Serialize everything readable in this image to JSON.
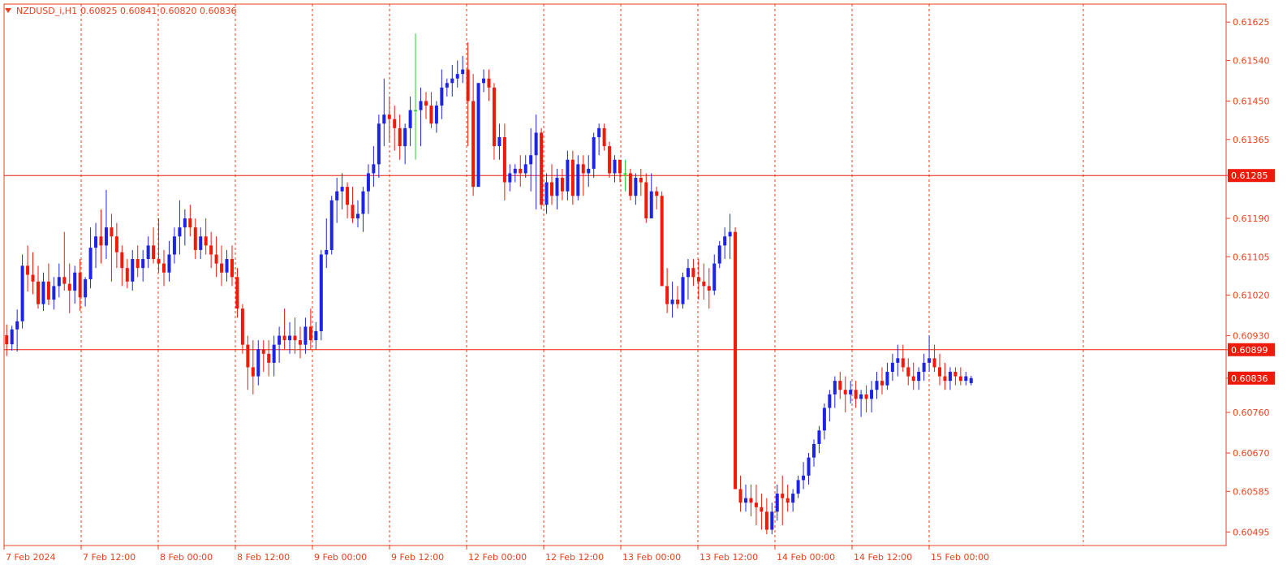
{
  "header": {
    "symbol_timeframe": "NZDUSD_i,H1",
    "ohlc": "0.60825 0.60841 0.60820 0.60836",
    "collapse_icon": "triangle-down-icon"
  },
  "colors": {
    "background": "#ffffff",
    "frame": "#e8421c",
    "grid": "#e8421c",
    "bull": "#1d24e6",
    "bear": "#f01a0a",
    "doji": "#2ecb2e",
    "axis_text": "#e8421c",
    "hline": "#f01a0a"
  },
  "chart_data": {
    "type": "candlestick",
    "instrument": "NZDUSD_i",
    "timeframe": "H1",
    "ylim": [
      0.60465,
      0.61665
    ],
    "y_ticks": [
      "0.61625",
      "0.61540",
      "0.61450",
      "0.61365",
      "0.61285",
      "0.61190",
      "0.61105",
      "0.61020",
      "0.60930",
      "0.60899",
      "0.60836",
      "0.60760",
      "0.60670",
      "0.60585",
      "0.60495"
    ],
    "highlight_levels": [
      "0.61285",
      "0.60899",
      "0.60836"
    ],
    "x_ticks": [
      "7 Feb 2024",
      "7 Feb 12:00",
      "8 Feb 00:00",
      "8 Feb 12:00",
      "9 Feb 00:00",
      "9 Feb 12:00",
      "12 Feb 00:00",
      "12 Feb 12:00",
      "13 Feb 00:00",
      "13 Feb 12:00",
      "14 Feb 00:00",
      "14 Feb 12:00",
      "15 Feb 00:00"
    ],
    "horizontal_lines": [
      0.61285,
      0.60899
    ],
    "current_price": 0.60836,
    "bar_count": 190,
    "candles": [
      [
        0.60931,
        0.60955,
        0.60885,
        0.60911
      ],
      [
        0.60911,
        0.60952,
        0.60897,
        0.60944
      ],
      [
        0.60944,
        0.60988,
        0.60895,
        0.60962
      ],
      [
        0.60962,
        0.6111,
        0.60946,
        0.61085
      ],
      [
        0.61085,
        0.6113,
        0.61028,
        0.61065
      ],
      [
        0.61065,
        0.61115,
        0.61022,
        0.6105
      ],
      [
        0.6105,
        0.61085,
        0.6099,
        0.61
      ],
      [
        0.61,
        0.6107,
        0.60985,
        0.6105
      ],
      [
        0.6105,
        0.6109,
        0.60998,
        0.6101
      ],
      [
        0.6101,
        0.6106,
        0.60988,
        0.6104
      ],
      [
        0.6104,
        0.6109,
        0.61015,
        0.6106
      ],
      [
        0.6106,
        0.6116,
        0.6103,
        0.61045
      ],
      [
        0.61045,
        0.6109,
        0.6098,
        0.6103
      ],
      [
        0.6103,
        0.61085,
        0.61001,
        0.6107
      ],
      [
        0.6107,
        0.611,
        0.60985,
        0.61015
      ],
      [
        0.61015,
        0.6106,
        0.60995,
        0.61055
      ],
      [
        0.61055,
        0.6117,
        0.61035,
        0.61125
      ],
      [
        0.61125,
        0.6118,
        0.6108,
        0.6115
      ],
      [
        0.6115,
        0.6121,
        0.6109,
        0.6113
      ],
      [
        0.6113,
        0.61253,
        0.611,
        0.6117
      ],
      [
        0.6117,
        0.612,
        0.6105,
        0.6115
      ],
      [
        0.6115,
        0.6118,
        0.6108,
        0.61115
      ],
      [
        0.61115,
        0.6113,
        0.6104,
        0.6108
      ],
      [
        0.6108,
        0.611,
        0.61035,
        0.6105
      ],
      [
        0.6105,
        0.6112,
        0.6103,
        0.611
      ],
      [
        0.611,
        0.6113,
        0.6106,
        0.6108
      ],
      [
        0.6108,
        0.6112,
        0.6105,
        0.611
      ],
      [
        0.611,
        0.6115,
        0.6108,
        0.6113
      ],
      [
        0.6113,
        0.6117,
        0.6109,
        0.611
      ],
      [
        0.611,
        0.6119,
        0.6107,
        0.6109
      ],
      [
        0.6109,
        0.6112,
        0.6104,
        0.6107
      ],
      [
        0.6107,
        0.6114,
        0.6105,
        0.6111
      ],
      [
        0.6111,
        0.6117,
        0.6109,
        0.6115
      ],
      [
        0.6115,
        0.6123,
        0.6111,
        0.6117
      ],
      [
        0.6117,
        0.6121,
        0.6113,
        0.6119
      ],
      [
        0.6119,
        0.6122,
        0.6115,
        0.6117
      ],
      [
        0.6117,
        0.6119,
        0.611,
        0.6112
      ],
      [
        0.6112,
        0.6117,
        0.611,
        0.6115
      ],
      [
        0.6115,
        0.6119,
        0.6111,
        0.6113
      ],
      [
        0.6113,
        0.6116,
        0.6108,
        0.6111
      ],
      [
        0.6111,
        0.6115,
        0.6106,
        0.6109
      ],
      [
        0.6109,
        0.6113,
        0.6104,
        0.6107
      ],
      [
        0.6107,
        0.6112,
        0.6105,
        0.611
      ],
      [
        0.611,
        0.6113,
        0.6104,
        0.6106
      ],
      [
        0.6106,
        0.6108,
        0.6097,
        0.6099
      ],
      [
        0.6099,
        0.61,
        0.6089,
        0.6091
      ],
      [
        0.6091,
        0.6093,
        0.6081,
        0.6086
      ],
      [
        0.6086,
        0.6092,
        0.608,
        0.6084
      ],
      [
        0.6084,
        0.6092,
        0.6082,
        0.609
      ],
      [
        0.609,
        0.6092,
        0.6085,
        0.6089
      ],
      [
        0.6089,
        0.6092,
        0.6084,
        0.6087
      ],
      [
        0.6087,
        0.6093,
        0.6084,
        0.6091
      ],
      [
        0.6091,
        0.6095,
        0.6087,
        0.6093
      ],
      [
        0.6093,
        0.6099,
        0.609,
        0.6092
      ],
      [
        0.6092,
        0.6096,
        0.6089,
        0.6093
      ],
      [
        0.6093,
        0.6097,
        0.6089,
        0.6092
      ],
      [
        0.6092,
        0.6095,
        0.6088,
        0.6091
      ],
      [
        0.6091,
        0.6097,
        0.6089,
        0.6095
      ],
      [
        0.6095,
        0.6099,
        0.609,
        0.6092
      ],
      [
        0.6092,
        0.6096,
        0.609,
        0.6094
      ],
      [
        0.6094,
        0.6112,
        0.6092,
        0.6111
      ],
      [
        0.6111,
        0.6119,
        0.6108,
        0.6112
      ],
      [
        0.6112,
        0.6124,
        0.6111,
        0.6123
      ],
      [
        0.6123,
        0.6128,
        0.6118,
        0.6125
      ],
      [
        0.6125,
        0.6129,
        0.6121,
        0.6126
      ],
      [
        0.6126,
        0.6127,
        0.6119,
        0.6122
      ],
      [
        0.6122,
        0.6126,
        0.6118,
        0.6119
      ],
      [
        0.6119,
        0.6123,
        0.6117,
        0.612
      ],
      [
        0.612,
        0.6126,
        0.6116,
        0.6125
      ],
      [
        0.6125,
        0.6131,
        0.612,
        0.6129
      ],
      [
        0.6129,
        0.6135,
        0.6126,
        0.6131
      ],
      [
        0.6131,
        0.6142,
        0.6128,
        0.614
      ],
      [
        0.614,
        0.615,
        0.6135,
        0.6142
      ],
      [
        0.6142,
        0.6146,
        0.6136,
        0.6141
      ],
      [
        0.6141,
        0.6144,
        0.6134,
        0.6139
      ],
      [
        0.6139,
        0.6142,
        0.6132,
        0.6135
      ],
      [
        0.6135,
        0.614,
        0.6131,
        0.6139
      ],
      [
        0.6139,
        0.6146,
        0.6135,
        0.6143
      ],
      [
        0.6143,
        0.616,
        0.6132,
        0.6143
      ],
      [
        0.6143,
        0.6148,
        0.6135,
        0.6145
      ],
      [
        0.6145,
        0.6147,
        0.6141,
        0.6144
      ],
      [
        0.6144,
        0.6147,
        0.6139,
        0.614
      ],
      [
        0.614,
        0.6145,
        0.6138,
        0.6144
      ],
      [
        0.6144,
        0.6152,
        0.6141,
        0.6148
      ],
      [
        0.6148,
        0.615,
        0.6146,
        0.6149
      ],
      [
        0.6149,
        0.6153,
        0.6146,
        0.615
      ],
      [
        0.615,
        0.6154,
        0.6148,
        0.6151
      ],
      [
        0.6151,
        0.6155,
        0.6149,
        0.6152
      ],
      [
        0.6152,
        0.6158,
        0.6135,
        0.6145
      ],
      [
        0.6145,
        0.6151,
        0.6124,
        0.6126
      ],
      [
        0.6126,
        0.6149,
        0.6126,
        0.6149
      ],
      [
        0.6149,
        0.6152,
        0.6147,
        0.615
      ],
      [
        0.615,
        0.6152,
        0.6145,
        0.6148
      ],
      [
        0.6148,
        0.6149,
        0.6132,
        0.6135
      ],
      [
        0.6135,
        0.614,
        0.6132,
        0.6137
      ],
      [
        0.6137,
        0.614,
        0.6123,
        0.6127
      ],
      [
        0.6127,
        0.6131,
        0.6125,
        0.6129
      ],
      [
        0.6129,
        0.6131,
        0.6127,
        0.613
      ],
      [
        0.613,
        0.6133,
        0.6126,
        0.6129
      ],
      [
        0.6129,
        0.6133,
        0.6128,
        0.6131
      ],
      [
        0.6131,
        0.6139,
        0.6125,
        0.6133
      ],
      [
        0.6133,
        0.6142,
        0.6121,
        0.6138
      ],
      [
        0.6138,
        0.6139,
        0.6121,
        0.6122
      ],
      [
        0.6122,
        0.6129,
        0.612,
        0.6127
      ],
      [
        0.6127,
        0.6131,
        0.6122,
        0.6124
      ],
      [
        0.6124,
        0.613,
        0.6121,
        0.6128
      ],
      [
        0.6128,
        0.613,
        0.6123,
        0.6125
      ],
      [
        0.6125,
        0.6134,
        0.6123,
        0.6132
      ],
      [
        0.6132,
        0.6134,
        0.6122,
        0.6124
      ],
      [
        0.6124,
        0.6133,
        0.6123,
        0.6131
      ],
      [
        0.6131,
        0.6133,
        0.6124,
        0.6129
      ],
      [
        0.6129,
        0.6133,
        0.6126,
        0.613
      ],
      [
        0.613,
        0.6138,
        0.6128,
        0.6137
      ],
      [
        0.6137,
        0.614,
        0.6133,
        0.6139
      ],
      [
        0.6139,
        0.614,
        0.6134,
        0.6135
      ],
      [
        0.6135,
        0.6136,
        0.6128,
        0.6129
      ],
      [
        0.6129,
        0.6133,
        0.6127,
        0.6132
      ],
      [
        0.6132,
        0.6132,
        0.6127,
        0.6129
      ],
      [
        0.6129,
        0.6132,
        0.6125,
        0.6129
      ],
      [
        0.6129,
        0.613,
        0.6123,
        0.6124
      ],
      [
        0.6124,
        0.6129,
        0.6122,
        0.6128
      ],
      [
        0.6128,
        0.613,
        0.6124,
        0.6127
      ],
      [
        0.6127,
        0.6129,
        0.6118,
        0.6119
      ],
      [
        0.6119,
        0.6129,
        0.612,
        0.6125
      ],
      [
        0.6125,
        0.6126,
        0.6121,
        0.6124
      ],
      [
        0.6124,
        0.6125,
        0.6105,
        0.6104
      ],
      [
        0.6104,
        0.6108,
        0.6098,
        0.61
      ],
      [
        0.61,
        0.6105,
        0.6097,
        0.6101
      ],
      [
        0.6101,
        0.6104,
        0.6099,
        0.61
      ],
      [
        0.61,
        0.6107,
        0.6099,
        0.6106
      ],
      [
        0.6106,
        0.611,
        0.6101,
        0.6108
      ],
      [
        0.6108,
        0.611,
        0.6104,
        0.6106
      ],
      [
        0.6106,
        0.611,
        0.6101,
        0.6105
      ],
      [
        0.6105,
        0.6109,
        0.6101,
        0.6104
      ],
      [
        0.6104,
        0.6108,
        0.6099,
        0.6103
      ],
      [
        0.6103,
        0.6111,
        0.6102,
        0.6109
      ],
      [
        0.6109,
        0.6114,
        0.6108,
        0.6113
      ],
      [
        0.6113,
        0.6117,
        0.611,
        0.6115
      ],
      [
        0.6115,
        0.612,
        0.611,
        0.6116
      ],
      [
        0.6116,
        0.6117,
        0.6063,
        0.6059
      ],
      [
        0.6059,
        0.6062,
        0.6054,
        0.6056
      ],
      [
        0.6056,
        0.606,
        0.6054,
        0.6057
      ],
      [
        0.6057,
        0.606,
        0.6053,
        0.6056
      ],
      [
        0.6056,
        0.606,
        0.6051,
        0.6055
      ],
      [
        0.6055,
        0.6058,
        0.605,
        0.6054
      ],
      [
        0.6054,
        0.6057,
        0.6049,
        0.605
      ],
      [
        0.605,
        0.6056,
        0.6049,
        0.6054
      ],
      [
        0.6054,
        0.606,
        0.6052,
        0.6058
      ],
      [
        0.6058,
        0.6062,
        0.6051,
        0.6057
      ],
      [
        0.6057,
        0.606,
        0.6054,
        0.6056
      ],
      [
        0.6056,
        0.6059,
        0.6054,
        0.6058
      ],
      [
        0.6058,
        0.6062,
        0.6057,
        0.6061
      ],
      [
        0.6061,
        0.6065,
        0.6059,
        0.6062
      ],
      [
        0.6062,
        0.6067,
        0.606,
        0.6066
      ],
      [
        0.6066,
        0.607,
        0.6064,
        0.6069
      ],
      [
        0.6069,
        0.6073,
        0.6067,
        0.6072
      ],
      [
        0.6072,
        0.6078,
        0.607,
        0.6077
      ],
      [
        0.6077,
        0.6081,
        0.6074,
        0.608
      ],
      [
        0.608,
        0.6084,
        0.6077,
        0.6083
      ],
      [
        0.6083,
        0.6085,
        0.6079,
        0.6081
      ],
      [
        0.6081,
        0.6084,
        0.6076,
        0.608
      ],
      [
        0.608,
        0.6083,
        0.6078,
        0.6081
      ],
      [
        0.6081,
        0.6083,
        0.6077,
        0.6079
      ],
      [
        0.6079,
        0.6081,
        0.6075,
        0.608
      ],
      [
        0.608,
        0.6082,
        0.6076,
        0.6079
      ],
      [
        0.6079,
        0.6083,
        0.6076,
        0.6081
      ],
      [
        0.6081,
        0.6085,
        0.6079,
        0.6083
      ],
      [
        0.6083,
        0.6086,
        0.608,
        0.6082
      ],
      [
        0.6082,
        0.6087,
        0.6081,
        0.6085
      ],
      [
        0.6085,
        0.6089,
        0.6083,
        0.6087
      ],
      [
        0.6087,
        0.6091,
        0.6084,
        0.6088
      ],
      [
        0.6088,
        0.6091,
        0.6085,
        0.6086
      ],
      [
        0.6086,
        0.6088,
        0.6082,
        0.6084
      ],
      [
        0.6084,
        0.6087,
        0.6081,
        0.6083
      ],
      [
        0.6083,
        0.6086,
        0.6081,
        0.6085
      ],
      [
        0.6085,
        0.6089,
        0.6083,
        0.6087
      ],
      [
        0.6087,
        0.6093,
        0.6085,
        0.6088
      ],
      [
        0.6088,
        0.6091,
        0.6085,
        0.6086
      ],
      [
        0.6086,
        0.6089,
        0.6082,
        0.6084
      ],
      [
        0.6084,
        0.6087,
        0.6081,
        0.6083
      ],
      [
        0.6083,
        0.6086,
        0.6081,
        0.6085
      ],
      [
        0.6085,
        0.6086,
        0.6082,
        0.6084
      ],
      [
        0.6084,
        0.6086,
        0.6082,
        0.6083
      ],
      [
        0.6083,
        0.6085,
        0.6082,
        0.6084
      ],
      [
        0.60825,
        0.60841,
        0.6082,
        0.60836
      ]
    ]
  }
}
